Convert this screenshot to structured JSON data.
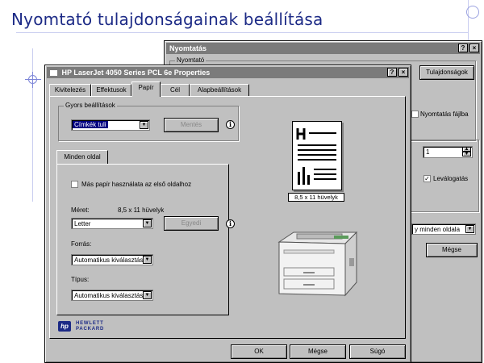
{
  "slide": {
    "title": "Nyomtató tulajdonságainak beállítása"
  },
  "back_dialog": {
    "title": "Nyomtatás",
    "printer_group_label": "Nyomtató",
    "properties_button": "Tulajdonságok",
    "print_to_file_label": "Nyomtatás fájlba",
    "copies_value": "1",
    "collate_label": "Leválogatás",
    "print_what_value": "y minden oldala",
    "cancel_button": "Mégse"
  },
  "props": {
    "title": "HP LaserJet 4050 Series PCL 6e Properties",
    "tabs": [
      "Kivitelezés",
      "Effektusok",
      "Papír",
      "Cél",
      "Alapbeállítások"
    ],
    "active_tab": "Papír",
    "quick_sets_label": "Gyors beállítások",
    "quick_sets_value": "Címkék tuli",
    "save_button": "Mentés",
    "all_pages_tab": "Minden oldal",
    "use_different_first_page": "Más papír használata az első oldalhoz",
    "size_label": "Méret:",
    "size_dimensions": "8,5 x 11 hüvelyk",
    "size_value": "Letter",
    "custom_button": "Egyedi",
    "source_label": "Forrás:",
    "source_value": "Automatikus kiválasztás",
    "type_label": "Típus:",
    "type_value": "Automatikus kiválasztás",
    "preview_caption": "8,5 x 11 hüvelyk",
    "hp_logo_line1": "HEWLETT",
    "hp_logo_line2": "PACKARD",
    "ok_button": "OK",
    "cancel_button": "Mégse",
    "help_button": "Súgó"
  },
  "colors": {
    "title_blue": "#1c2a86",
    "dialog_gray": "#c0c0c0",
    "selection_blue": "#000080"
  }
}
